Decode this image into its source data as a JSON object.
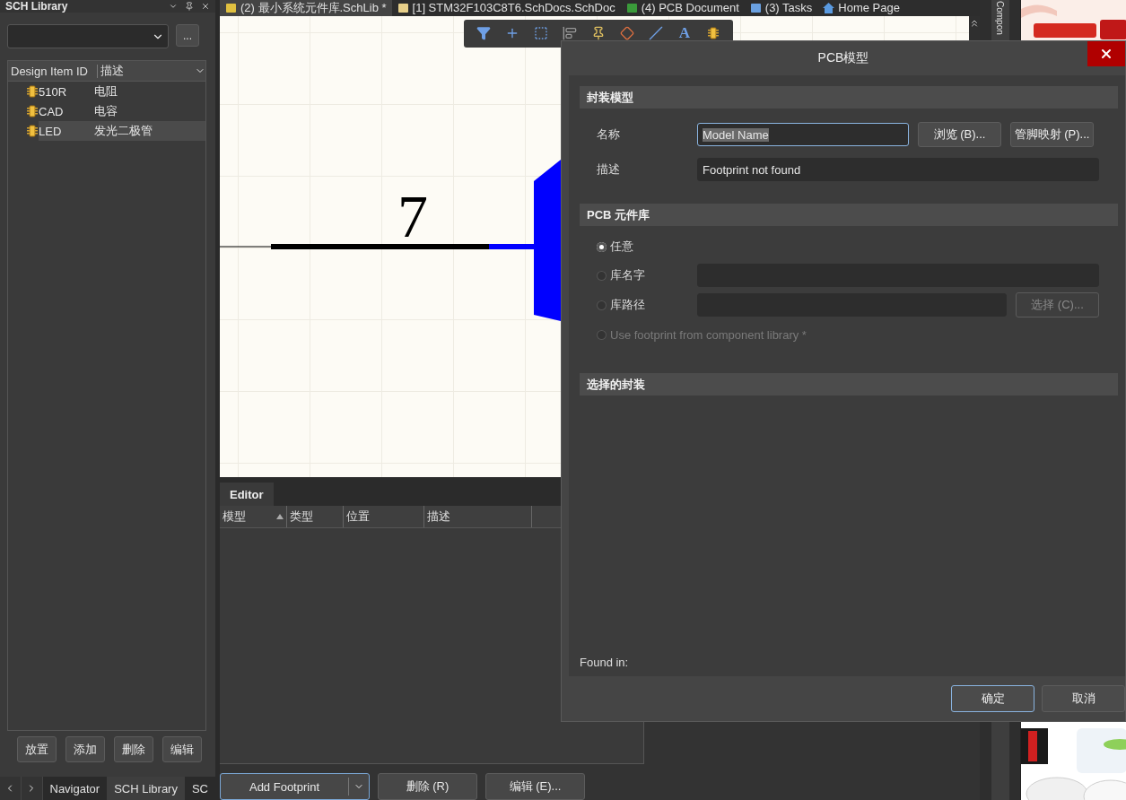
{
  "left_panel": {
    "title": "SCH Library",
    "more_button": "...",
    "table": {
      "columns": [
        "Design Item ID",
        "描述"
      ],
      "rows": [
        {
          "id": "510R",
          "description": "电阻",
          "selected": false
        },
        {
          "id": "CAD",
          "description": "电容",
          "selected": false
        },
        {
          "id": "LED",
          "description": "发光二极管",
          "selected": true
        }
      ]
    },
    "buttons": [
      "放置",
      "添加",
      "删除",
      "编辑"
    ]
  },
  "panel_tabs": [
    {
      "label": "Navigator",
      "selected": false
    },
    {
      "label": "SCH Library",
      "selected": true
    },
    {
      "label": "SC",
      "selected": false
    }
  ],
  "document_tabs": [
    {
      "label": "(2) 最小系统元件库.SchLib *",
      "selected": true,
      "kind": "schlib"
    },
    {
      "label": "[1] STM32F103C8T6.SchDocs.SchDoc",
      "selected": false,
      "kind": "folder"
    },
    {
      "label": "(4) PCB Document",
      "selected": false,
      "kind": "pcb"
    },
    {
      "label": "(3) Tasks",
      "selected": false,
      "kind": "tasks"
    },
    {
      "label": "Home Page",
      "selected": false,
      "kind": "home"
    }
  ],
  "toolbar": [
    {
      "kind": "filter"
    },
    {
      "kind": "cross"
    },
    {
      "kind": "select"
    },
    {
      "kind": "align"
    },
    {
      "kind": "pin"
    },
    {
      "kind": "diamond"
    },
    {
      "kind": "line"
    },
    {
      "kind": "text",
      "label": "A"
    },
    {
      "kind": "part"
    }
  ],
  "schematic": {
    "pin_number": "7"
  },
  "editor": {
    "title": "Editor",
    "columns": [
      {
        "label": "模型",
        "sorted": true
      },
      {
        "label": "类型",
        "sorted": false
      },
      {
        "label": "位置",
        "sorted": false
      },
      {
        "label": "描述",
        "sorted": false
      }
    ]
  },
  "footer_buttons": [
    {
      "label": "Add Footprint",
      "kind": "split"
    },
    {
      "label": "删除 (R)",
      "kind": "plain"
    },
    {
      "label": "编辑 (E)...",
      "kind": "plain"
    }
  ],
  "side_tab": "Compon",
  "dialog": {
    "title": "PCB模型",
    "footprint_model": {
      "heading": "封装模型",
      "name_label": "名称",
      "name_value": "Model Name",
      "name_text_selected": true,
      "browse_button": "浏览 (B)...",
      "pin_map_button": "管脚映射 (P)...",
      "description_label": "描述",
      "description_value": "Footprint not found"
    },
    "pcb_library": {
      "heading": "PCB 元件库",
      "options": [
        {
          "label": "任意",
          "selected": true,
          "disabled": false,
          "kind": "plain"
        },
        {
          "label": "库名字",
          "selected": false,
          "disabled": false,
          "kind": "field"
        },
        {
          "label": "库路径",
          "selected": false,
          "disabled": false,
          "kind": "field_button",
          "button": "选择 (C)...",
          "button_disabled": true
        },
        {
          "label": "Use footprint from component library *",
          "selected": false,
          "disabled": true,
          "kind": "plain"
        }
      ]
    },
    "selected_footprint": {
      "heading": "选择的封装",
      "found_in": "Found in:"
    },
    "buttons": [
      {
        "label": "确定",
        "default": true
      },
      {
        "label": "取消",
        "default": false
      }
    ]
  }
}
